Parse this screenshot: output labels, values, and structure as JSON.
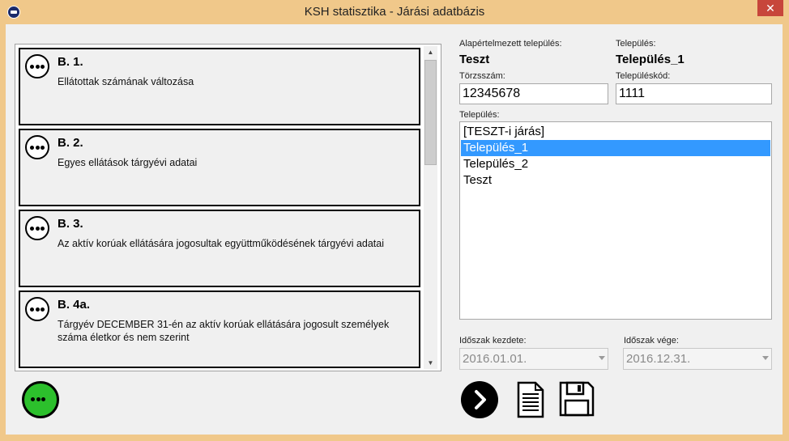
{
  "window": {
    "title": "KSH statisztika - Járási adatbázis",
    "close_glyph": "✕"
  },
  "items": [
    {
      "title": "B. 1.",
      "desc": "Ellátottak számának változása"
    },
    {
      "title": "B. 2.",
      "desc": "Egyes ellátások tárgyévi adatai"
    },
    {
      "title": "B. 3.",
      "desc": "Az aktív korúak ellátására jogosultak együttműködésének tárgyévi adatai"
    },
    {
      "title": "B. 4a.",
      "desc": "Tárgyév DECEMBER 31-én az aktív korúak ellátására jogosult személyek száma életkor és nem szerint"
    }
  ],
  "form": {
    "default_settlement_label": "Alapértelmezett település:",
    "default_settlement_value": "Teszt",
    "settlement_label": "Település:",
    "settlement_value": "Település_1",
    "torzsszam_label": "Törzsszám:",
    "torzsszam_value": "12345678",
    "telepuleskod_label": "Településkód:",
    "telepuleskod_value": "1111",
    "list_label": "Település:",
    "list_items": [
      "[TESZT-i járás]",
      "Település_1",
      "Település_2",
      "Teszt"
    ],
    "selected_index": 1,
    "period_start_label": "Időszak kezdete:",
    "period_start_value": "2016.01.01.",
    "period_end_label": "Időszak vége:",
    "period_end_value": "2016.12.31."
  },
  "colors": {
    "title_bar": "#f0c88a",
    "close": "#c7463b",
    "selection": "#3399ff",
    "green_button": "#2cc02c"
  }
}
